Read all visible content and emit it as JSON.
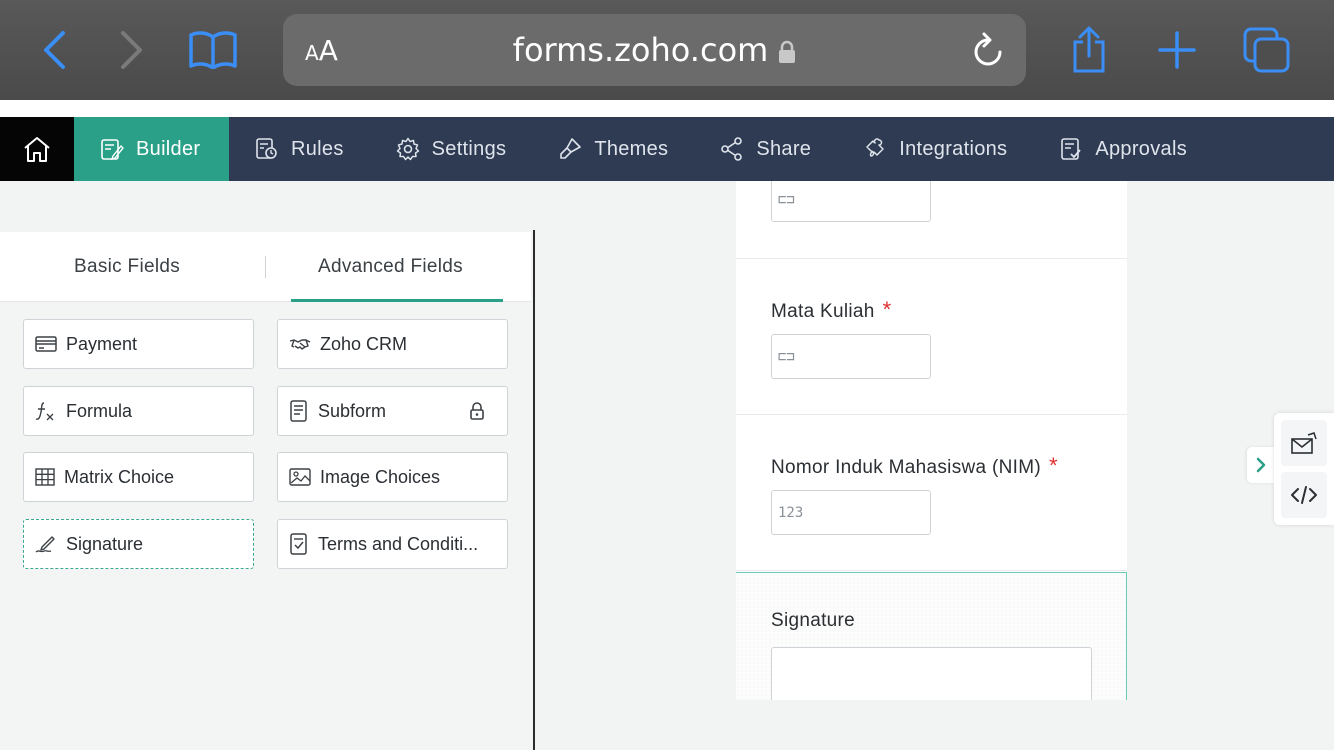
{
  "browser": {
    "text_size_small": "A",
    "text_size_large": "A",
    "url": "forms.zoho.com"
  },
  "nav": {
    "tabs": [
      {
        "label": "Builder",
        "icon": "builder-icon"
      },
      {
        "label": "Rules",
        "icon": "rules-icon"
      },
      {
        "label": "Settings",
        "icon": "gear-icon"
      },
      {
        "label": "Themes",
        "icon": "paint-brush-icon"
      },
      {
        "label": "Share",
        "icon": "share-icon"
      },
      {
        "label": "Integrations",
        "icon": "puzzle-icon"
      },
      {
        "label": "Approvals",
        "icon": "approvals-icon"
      }
    ],
    "active": "Builder"
  },
  "panel": {
    "tabs": [
      "Basic Fields",
      "Advanced Fields"
    ],
    "active_tab": "Advanced Fields",
    "fields": [
      {
        "label": "Payment",
        "icon": "credit-card-icon"
      },
      {
        "label": "Zoho CRM",
        "icon": "handshake-icon"
      },
      {
        "label": "Formula",
        "icon": "formula-icon"
      },
      {
        "label": "Subform",
        "icon": "subform-icon",
        "locked": true
      },
      {
        "label": "Matrix Choice",
        "icon": "grid-icon"
      },
      {
        "label": "Image Choices",
        "icon": "image-icon"
      },
      {
        "label": "Signature",
        "icon": "pen-icon"
      },
      {
        "label": "Terms and Conditi..."
      }
    ]
  },
  "form": {
    "fields": [
      {
        "label": "",
        "placeholder_glyph": "⊏⊐"
      },
      {
        "label": "Mata Kuliah",
        "required": true,
        "placeholder_glyph": "⊏⊐"
      },
      {
        "label": "Nomor Induk Mahasiswa (NIM)",
        "required": true,
        "placeholder_glyph": "123"
      },
      {
        "label": "Signature",
        "required": false
      }
    ],
    "required_mark": "*"
  },
  "colors": {
    "accent": "#2aa088",
    "nav_bg": "#2e3b52",
    "required": "#e12e2e",
    "safari_blue": "#3a8ef6"
  }
}
